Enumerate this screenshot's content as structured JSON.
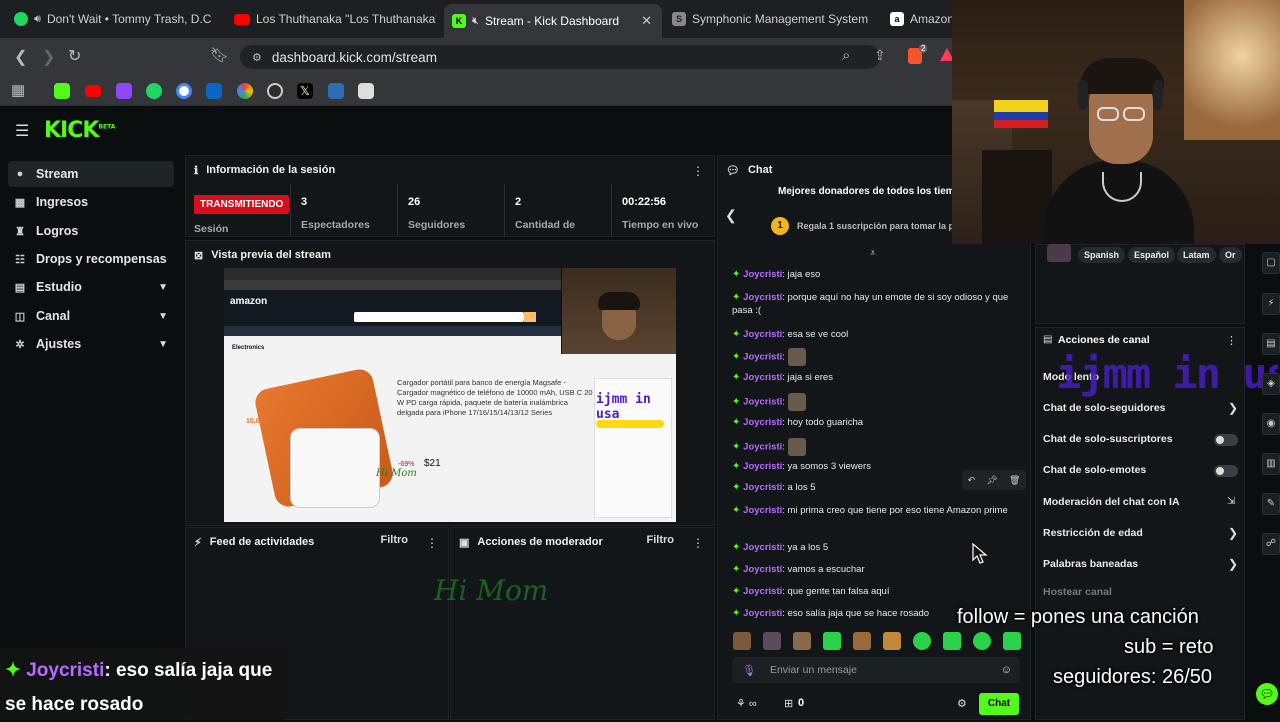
{
  "browser": {
    "tabs": [
      {
        "label": "Don't Wait • Tommy Trash, D.C",
        "icon": "spotify-icon",
        "color": "#1ed760"
      },
      {
        "label": "Los Thuthanaka \"Los Thuthanaka\"",
        "icon": "youtube-icon",
        "color": "#ff0000"
      },
      {
        "label": "Stream - Kick Dashboard",
        "icon": "kick-icon",
        "color": "#53fc18"
      },
      {
        "label": "Symphonic Management System",
        "icon": "symphonic-icon",
        "color": "#888888"
      },
      {
        "label": "Amazon",
        "icon": "amazon-icon",
        "color": "#ffffff"
      }
    ],
    "url": "dashboard.kick.com/stream",
    "extension_badge": "2"
  },
  "kick": {
    "logo": "KICK",
    "logo_sup": "BETA"
  },
  "sidebar": {
    "items": [
      {
        "label": "Stream",
        "icon": "stream-icon",
        "glyph": "●"
      },
      {
        "label": "Ingresos",
        "icon": "income-icon",
        "glyph": "▦"
      },
      {
        "label": "Logros",
        "icon": "trophy-icon",
        "glyph": "♜"
      },
      {
        "label": "Drops y recompensas",
        "icon": "drops-icon",
        "glyph": "☷"
      },
      {
        "label": "Estudio",
        "icon": "studio-icon",
        "glyph": "▤"
      },
      {
        "label": "Canal",
        "icon": "channel-icon",
        "glyph": "◫"
      },
      {
        "label": "Ajustes",
        "icon": "settings-icon",
        "glyph": "✲"
      }
    ]
  },
  "session": {
    "title": "Información de la sesión",
    "status": "TRANSMITIENDO",
    "session_label": "Sesión",
    "stats": [
      {
        "value": "3",
        "label": "Espectadores"
      },
      {
        "value": "26",
        "label": "Seguidores"
      },
      {
        "value": "2",
        "label": "Cantidad de"
      },
      {
        "value": "00:22:56",
        "label": "Tiempo en vivo"
      }
    ]
  },
  "preview": {
    "title": "Vista previa del stream",
    "product_title": "Cargador portátil para banco de energía Magsafe - Cargador magnético de teléfono de 10000 mAh, USB C 20 W PD carga rápida, paquete de batería inalámbrica delgada para iPhone 17/16/15/14/13/12 Series",
    "price": "$21",
    "discount": "-69%",
    "category": "Electronics",
    "overlay": "ijmm in usa",
    "himom": "Hi Mom",
    "capacity": "10,000"
  },
  "feed": {
    "title": "Feed de actividades",
    "filter": "Filtro"
  },
  "mod": {
    "title": "Acciones de moderador",
    "filter": "Filtro",
    "watermark": "Hi Mom"
  },
  "chat": {
    "title": "Chat",
    "top_donors": "Mejores donadores de todos los tiem",
    "gift_text": "Regala 1 suscripción para tomar la po",
    "gift_rank": "1",
    "messages": [
      {
        "user": "Joycristi",
        "text": "jaja eso"
      },
      {
        "user": "Joycristi",
        "text": "porque aquí no hay un emote de si soy odioso y que pasa :("
      },
      {
        "user": "Joycristi",
        "text": "esa se ve cool"
      },
      {
        "user": "Joycristi",
        "text": ""
      },
      {
        "user": "Joycristi",
        "text": "jaja si eres"
      },
      {
        "user": "Joycristi",
        "text": ""
      },
      {
        "user": "Joycristi",
        "text": "hoy todo guaricha"
      },
      {
        "user": "Joycristi",
        "text": ""
      },
      {
        "user": "Joycristi",
        "text": "ya somos 3 viewers"
      },
      {
        "user": "Joycristi",
        "text": "a los 5"
      },
      {
        "user": "Joycristi",
        "text": "mi prima creo que tiene por eso tiene Amazon prime"
      },
      {
        "user": "Joycristi",
        "text": "ya a los 5"
      },
      {
        "user": "Joycristi",
        "text": "vamos a escuchar"
      },
      {
        "user": "Joycristi",
        "text": "que gente tan falsa aquí"
      },
      {
        "user": "Joycristi",
        "text": "eso salía jaja que se hace rosado"
      }
    ],
    "input_placeholder": "Enviar un mensaje",
    "viewer_count": "0",
    "chat_button": "Chat"
  },
  "channel": {
    "tags": [
      "Spanish",
      "Español",
      "Latam",
      "Or"
    ],
    "actions_title": "Acciones de canal",
    "items": [
      {
        "label": "Modo lento"
      },
      {
        "label": "Chat de solo-seguidores"
      },
      {
        "label": "Chat de solo-suscriptores"
      },
      {
        "label": "Chat de solo-emotes"
      },
      {
        "label": "Moderación del chat con IA"
      },
      {
        "label": "Restricción de edad"
      },
      {
        "label": "Palabras baneadas"
      },
      {
        "label": "Hostear canal"
      }
    ],
    "overlay_text": "ijmm in usa"
  },
  "stream_overlay": {
    "follow": "follow = pones una canción",
    "sub": "sub = reto",
    "followers": "seguidores: 26/50",
    "chat_user": "Joycristi",
    "chat_text": ": eso salía jaja que se hace rosado"
  },
  "colors": {
    "kick_green": "#53fc18",
    "live_red": "#d90e1c",
    "user_purple": "#b86cff",
    "overlay_purple": "#5a1ee0"
  }
}
